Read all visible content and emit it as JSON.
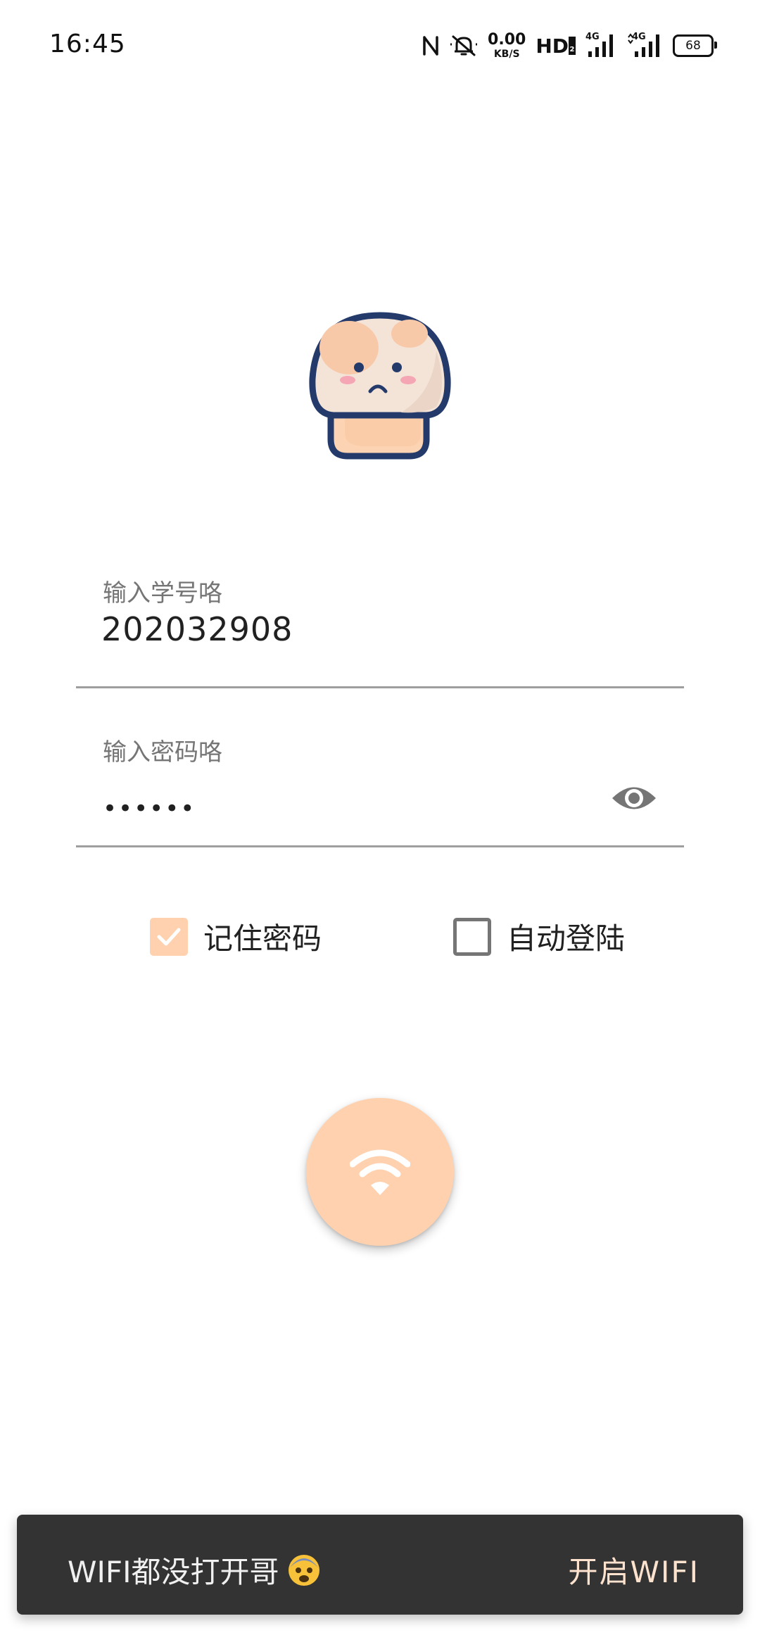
{
  "status_bar": {
    "time": "16:45",
    "net_speed_value": "0.00",
    "net_speed_unit": "KB/S",
    "hd_label": "HD",
    "signal_1": "4G",
    "signal_2": "4G",
    "battery": "68",
    "icons": [
      "nfc-icon",
      "mute-icon",
      "hd-icon",
      "signal-4g-icon",
      "signal-4g-icon",
      "battery-icon"
    ]
  },
  "login": {
    "student_id": {
      "label": "输入学号咯",
      "value": "202032908"
    },
    "password": {
      "label": "输入密码咯",
      "masked_value": "••••••",
      "toggle_icon": "eye-icon"
    },
    "remember_password": {
      "label": "记住密码",
      "checked": true
    },
    "auto_login": {
      "label": "自动登陆",
      "checked": false
    },
    "connect_button_icon": "wifi-icon"
  },
  "snackbar": {
    "message": "WIFI都没打开哥",
    "emoji_icon": "fearful-face-icon",
    "action_label": "开启WIFI"
  },
  "colors": {
    "accent": "#ffd1ae",
    "snackbar_bg": "#333333",
    "underline": "#9e9e9e"
  }
}
